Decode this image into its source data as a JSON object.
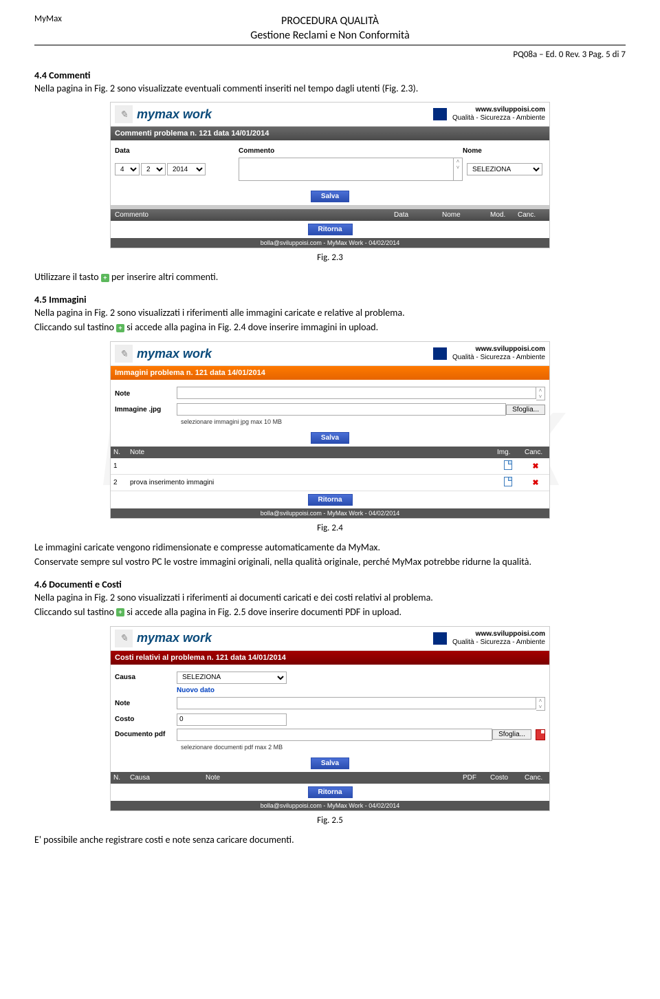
{
  "header": {
    "company": "MyMax",
    "title1": "PROCEDURA QUALITÀ",
    "title2": "Gestione Reclami e Non Conformità",
    "docref": "PQ08a – Ed. 0 Rev. 3 Pag. 5 di 7"
  },
  "s44": {
    "title": "4.4 Commenti",
    "p1": "Nella pagina in Fig. 2 sono visualizzate eventuali commenti inseriti nel tempo dagli utenti (Fig. 2.3).",
    "p2a": "Utilizzare il tasto",
    "p2b": "per inserire altri commenti."
  },
  "s45": {
    "title": "4.5 Immagini",
    "p1": "Nella pagina in Fig. 2 sono visualizzati i riferimenti alle immagini caricate e relative al problema.",
    "p2a": "Cliccando sul tastino",
    "p2b": "si accede alla pagina in Fig. 2.4 dove inserire immagini in upload.",
    "p3": "Le immagini caricate vengono ridimensionate e compresse automaticamente da MyMax.",
    "p4": "Conservate sempre sul vostro PC le vostre immagini originali, nella qualità originale, perché MyMax potrebbe ridurne la qualità."
  },
  "s46": {
    "title": "4.6 Documenti e Costi",
    "p1": "Nella pagina in Fig. 2 sono visualizzati i riferimenti ai documenti caricati e dei costi relativi al problema.",
    "p2a": "Cliccando sul tastino",
    "p2b": "si accede alla pagina in Fig. 2.5 dove inserire documenti PDF in upload.",
    "p3": "E' possibile anche registrare costi e note senza caricare documenti."
  },
  "captions": {
    "f23": "Fig. 2.3",
    "f24": "Fig. 2.4",
    "f25": "Fig. 2.5"
  },
  "ss": {
    "brand": "mymax work",
    "url": "www.sviluppoisi.com",
    "tagline": "Qualità - Sicurezza - Ambiente",
    "salva": "Salva",
    "ritorna": "Ritorna",
    "footer": "bolla@sviluppoisi.com - MyMax Work - 04/02/2014"
  },
  "fig23": {
    "bar": "Commenti problema n. 121 data 14/01/2014",
    "data": "Data",
    "commento": "Commento",
    "nome": "Nome",
    "d": "4",
    "m": "2",
    "y": "2014",
    "seleziona": "SELEZIONA",
    "th": {
      "c1": "Commento",
      "c2": "Data",
      "c3": "Nome",
      "c4": "Mod.",
      "c5": "Canc."
    }
  },
  "fig24": {
    "bar": "Immagini problema n. 121 data 14/01/2014",
    "note": "Note",
    "img": "Immagine .jpg",
    "sfoglia": "Sfoglia...",
    "hint": "selezionare immagini jpg max 10 MB",
    "th": {
      "n": "N.",
      "note": "Note",
      "img": "Img.",
      "canc": "Canc."
    },
    "r1n": "1",
    "r1note": "",
    "r2n": "2",
    "r2note": "prova inserimento immagini"
  },
  "fig25": {
    "bar": "Costi relativi al problema n. 121 data 14/01/2014",
    "causa": "Causa",
    "seleziona": "SELEZIONA",
    "nuovo": "Nuovo dato",
    "note": "Note",
    "costo": "Costo",
    "costo_val": "0",
    "doc": "Documento pdf",
    "sfoglia": "Sfoglia...",
    "hint": "selezionare documenti pdf max 2 MB",
    "th": {
      "n": "N.",
      "causa": "Causa",
      "note": "Note",
      "pdf": "PDF",
      "costo": "Costo",
      "canc": "Canc."
    }
  }
}
